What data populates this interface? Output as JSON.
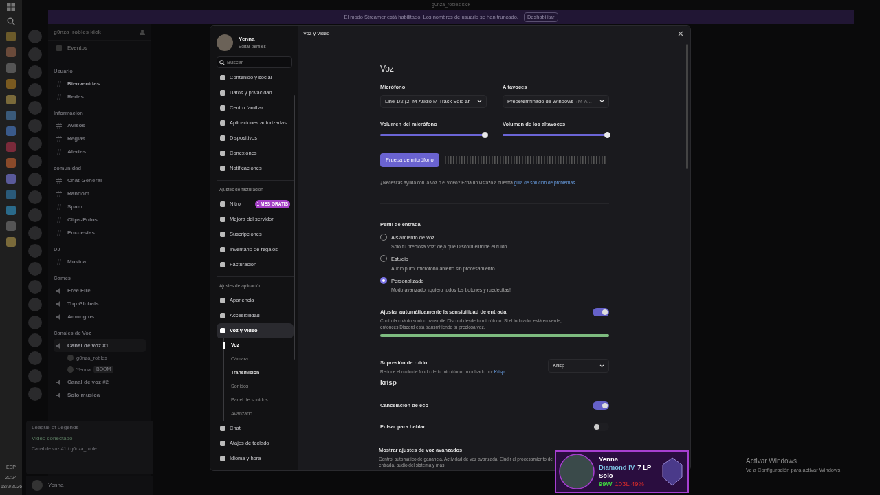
{
  "window": {
    "title": "g0nza_robles kick"
  },
  "banner": {
    "text": "El modo Streamer está habilitado. Los nombres de usuario se han truncado.",
    "button": "Deshabilitar"
  },
  "server": {
    "name": "g0nza_robles kick",
    "events": "Eventos"
  },
  "channels": [
    {
      "kind": "category",
      "name": "Usuario"
    },
    {
      "kind": "text",
      "name": "Bienvenidas",
      "unread": true
    },
    {
      "kind": "text",
      "name": "Redes",
      "unread": false
    },
    {
      "kind": "category",
      "name": "Informacion"
    },
    {
      "kind": "text",
      "name": "Avisos",
      "unread": false
    },
    {
      "kind": "text",
      "name": "Reglas",
      "unread": false
    },
    {
      "kind": "text",
      "name": "Alertas",
      "unread": false
    },
    {
      "kind": "category",
      "name": "comunidad"
    },
    {
      "kind": "text",
      "name": "Chat-General",
      "unread": false
    },
    {
      "kind": "text",
      "name": "Random",
      "unread": false
    },
    {
      "kind": "text",
      "name": "Spam",
      "unread": false
    },
    {
      "kind": "text",
      "name": "Clips-Fotos",
      "unread": false
    },
    {
      "kind": "text",
      "name": "Encuestas",
      "unread": false
    },
    {
      "kind": "category",
      "name": "DJ"
    },
    {
      "kind": "text",
      "name": "Musica",
      "unread": false
    },
    {
      "kind": "category",
      "name": "Games"
    },
    {
      "kind": "voice",
      "name": "Free Fire",
      "unread": false
    },
    {
      "kind": "voice",
      "name": "Top Globals",
      "unread": false
    },
    {
      "kind": "voice",
      "name": "Among us",
      "unread": false
    },
    {
      "kind": "category",
      "name": "Canales de Voz"
    },
    {
      "kind": "voice",
      "name": "Canal de voz #1",
      "unread": true,
      "children": [
        {
          "name": "g0nza_robles"
        },
        {
          "name": "Yenna",
          "tag": "BOOM"
        }
      ]
    },
    {
      "kind": "voice",
      "name": "Canal de voz #2",
      "unread": false
    },
    {
      "kind": "voice",
      "name": "Solo musica",
      "unread": false
    }
  ],
  "activity": {
    "game": "League of Legends",
    "status": "Video conectado",
    "channel": "Canal de voz #1 / g0nza_roble..."
  },
  "user_panel": {
    "name": "Yenna"
  },
  "taskbar": {
    "language": "ESP",
    "time": "20:24",
    "date": "18/2/2026"
  },
  "settings": {
    "profile": {
      "name": "Yenna",
      "edit": "Editar perfiles"
    },
    "search": {
      "placeholder": "Buscar"
    },
    "nav": [
      {
        "kind": "item",
        "label": "Contenido y social",
        "selected": false
      },
      {
        "kind": "item",
        "label": "Datos y privacidad",
        "selected": false
      },
      {
        "kind": "item",
        "label": "Centro familiar",
        "selected": false
      },
      {
        "kind": "item",
        "label": "Aplicaciones autorizadas",
        "selected": false
      },
      {
        "kind": "item",
        "label": "Dispositivos",
        "selected": false
      },
      {
        "kind": "item",
        "label": "Conexiones",
        "selected": false
      },
      {
        "kind": "item",
        "label": "Notificaciones",
        "selected": false
      },
      {
        "kind": "header",
        "label": "Ajustes de facturación"
      },
      {
        "kind": "item",
        "label": "Nitro",
        "selected": false,
        "badge": "1 MES GRATIS"
      },
      {
        "kind": "item",
        "label": "Mejora del servidor",
        "selected": false
      },
      {
        "kind": "item",
        "label": "Suscripciones",
        "selected": false
      },
      {
        "kind": "item",
        "label": "Inventario de regalos",
        "selected": false
      },
      {
        "kind": "item",
        "label": "Facturación",
        "selected": false
      },
      {
        "kind": "header",
        "label": "Ajustes de aplicación"
      },
      {
        "kind": "item",
        "label": "Apariencia",
        "selected": false
      },
      {
        "kind": "item",
        "label": "Accesibilidad",
        "selected": false
      },
      {
        "kind": "item",
        "label": "Voz y video",
        "selected": true
      },
      {
        "kind": "sub",
        "label": "Voz",
        "selected": true
      },
      {
        "kind": "sub",
        "label": "Cámara",
        "selected": false
      },
      {
        "kind": "sub",
        "label": "Transmisión",
        "selected": false,
        "hover": true
      },
      {
        "kind": "sub",
        "label": "Sonidos",
        "selected": false
      },
      {
        "kind": "sub",
        "label": "Panel de sonidos",
        "selected": false
      },
      {
        "kind": "sub",
        "label": "Avanzado",
        "selected": false
      },
      {
        "kind": "item",
        "label": "Chat",
        "selected": false
      },
      {
        "kind": "item",
        "label": "Atajos de teclado",
        "selected": false
      },
      {
        "kind": "item",
        "label": "Idioma y hora",
        "selected": false
      }
    ],
    "page_title": "Voz y video",
    "section": "Voz",
    "devices": [
      {
        "label": "Micrófono",
        "value": "Line 1/2 (2- M-Audio M-Track Solo ar"
      },
      {
        "label": "Altavoces",
        "value": "Predeterminado de Windows",
        "suffix": "(M-A..."
      }
    ],
    "volumes": [
      {
        "label": "Volumen del micrófono",
        "level": 1
      },
      {
        "label": "Volumen de los altavoces",
        "level": 1
      }
    ],
    "mic_test": {
      "button": "Prueba de micrófono"
    },
    "help": {
      "text": "¿Necesitas ayuda con la voz o el video? Echa un vistazo a nuestra",
      "link": "guía de solución de problemas."
    },
    "input_profile": {
      "title": "Perfil de entrada",
      "options": [
        {
          "label": "Aislamiento de voz",
          "description": "Solo tu preciosa voz: deja que Discord elimine el ruido",
          "selected": false
        },
        {
          "label": "Estudio",
          "description": "Audio puro: micrófono abierto sin procesamiento",
          "selected": false
        },
        {
          "label": "Personalizado",
          "description": "Modo avanzado: ¡quiero todos los botones y ruedecitas!",
          "selected": true
        }
      ]
    },
    "sensitivity": {
      "title": "Ajustar automáticamente la sensibilidad de entrada",
      "description": "Controla cuánto sonido transmite Discord desde tu micrófono. Si el indicador está en verde, entonces Discord está transmitiendo tu preciosa voz.",
      "on": true,
      "level": 1
    },
    "noise": {
      "title": "Supresión de ruido",
      "description": "Reduce el ruido de fondo de tu micrófono. Impulsado por",
      "link": "Krisp.",
      "logo": "krisp",
      "value": "Krisp"
    },
    "toggles": [
      {
        "label": "Cancelación de eco",
        "on": true
      },
      {
        "label": "Pulsar para hablar",
        "on": false
      }
    ],
    "advanced": {
      "title": "Mostrar ajustes de voz avanzados",
      "description": "Control automático de ganancia, Actividad de voz avanzada, Eludir el procesamiento de entrada, audio del sistema y más"
    }
  },
  "rank_overlay": {
    "name": "Yenna",
    "rank": "Diamond IV",
    "lp": "7 LP",
    "queue": "Solo",
    "wins": "99W",
    "losses": "103L 49%"
  },
  "activation": {
    "title": "Activar Windows",
    "text": "Ve a Configuración para activar Windows."
  }
}
